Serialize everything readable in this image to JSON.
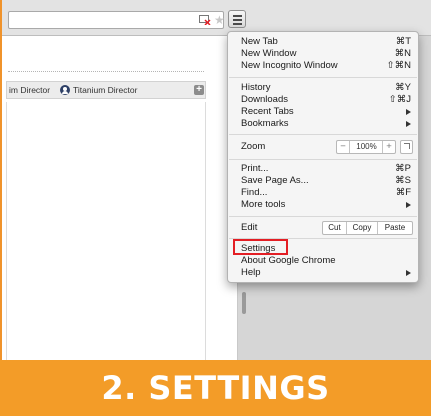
{
  "page": {
    "director_tabs": [
      "im Director",
      "Titanium Director"
    ],
    "zoom_level": "100%"
  },
  "menu": {
    "items": [
      {
        "label": "New Tab",
        "shortcut": "⌘T"
      },
      {
        "label": "New Window",
        "shortcut": "⌘N"
      },
      {
        "label": "New Incognito Window",
        "shortcut": "⇧⌘N"
      },
      {
        "label": "History",
        "shortcut": "⌘Y"
      },
      {
        "label": "Downloads",
        "shortcut": "⇧⌘J"
      },
      {
        "label": "Recent Tabs",
        "shortcut": ""
      },
      {
        "label": "Bookmarks",
        "shortcut": ""
      },
      {
        "label": "Zoom",
        "shortcut": ""
      },
      {
        "label": "Print...",
        "shortcut": "⌘P"
      },
      {
        "label": "Save Page As...",
        "shortcut": "⌘S"
      },
      {
        "label": "Find...",
        "shortcut": "⌘F"
      },
      {
        "label": "More tools",
        "shortcut": ""
      },
      {
        "label": "Edit",
        "shortcut": ""
      },
      {
        "label": "Settings",
        "shortcut": ""
      },
      {
        "label": "About Google Chrome",
        "shortcut": ""
      },
      {
        "label": "Help",
        "shortcut": ""
      }
    ],
    "zoom": {
      "minus": "−",
      "value": "100%",
      "plus": "+"
    },
    "edit": {
      "cut": "Cut",
      "copy": "Copy",
      "paste": "Paste"
    }
  },
  "banner": {
    "text": "2. SETTINGS"
  },
  "colors": {
    "banner": "#f39c28",
    "highlight": "#e31e24"
  }
}
